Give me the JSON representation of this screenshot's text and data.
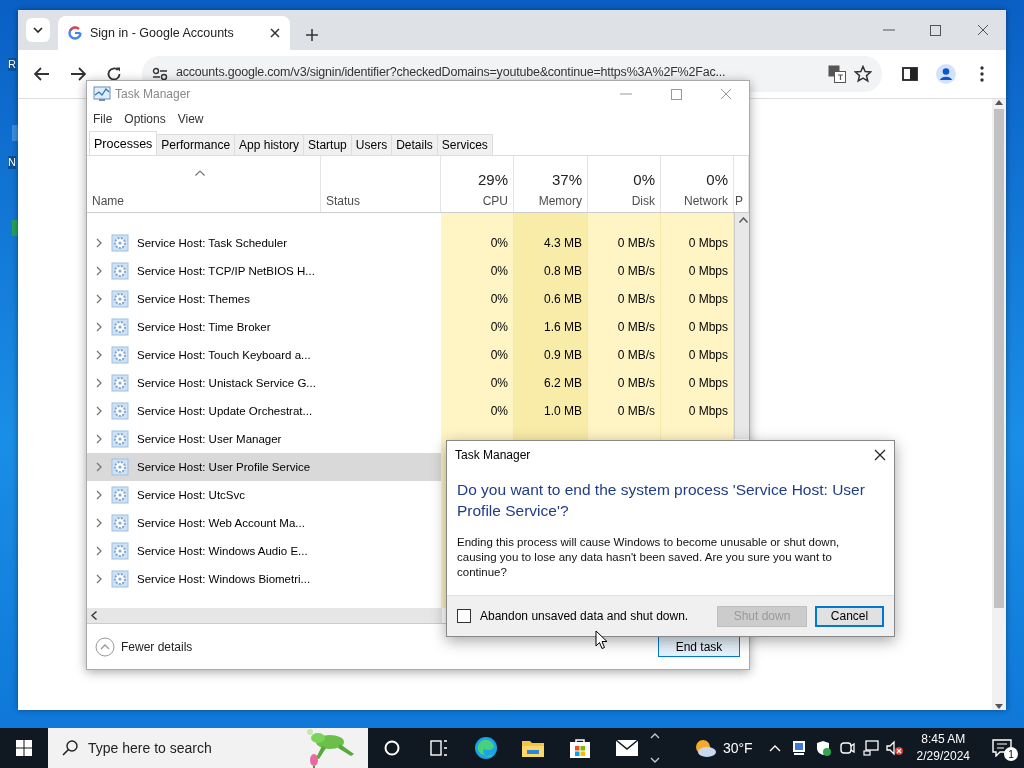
{
  "desktop": {
    "icon_labels": [
      "R",
      "N"
    ]
  },
  "browser": {
    "tabs": [
      {
        "title": "Sign in - Google Accounts",
        "selected": true
      }
    ],
    "url": "accounts.google.com/v3/signin/identifier?checkedDomains=youtube&continue=https%3A%2F%2Fac..."
  },
  "task_manager": {
    "title": "Task Manager",
    "menu": [
      "File",
      "Options",
      "View"
    ],
    "tabs": [
      {
        "label": "Processes",
        "selected": true
      },
      {
        "label": "Performance",
        "selected": false
      },
      {
        "label": "App history",
        "selected": false
      },
      {
        "label": "Startup",
        "selected": false
      },
      {
        "label": "Users",
        "selected": false
      },
      {
        "label": "Details",
        "selected": false
      },
      {
        "label": "Services",
        "selected": false
      }
    ],
    "columns": [
      {
        "label": "Name"
      },
      {
        "label": "Status"
      },
      {
        "usage": "29%",
        "label": "CPU"
      },
      {
        "usage": "37%",
        "label": "Memory"
      },
      {
        "usage": "0%",
        "label": "Disk"
      },
      {
        "usage": "0%",
        "label": "Network"
      },
      {
        "label": "P"
      }
    ],
    "rows": [
      {
        "name": "Service Host: Task Scheduler",
        "selected": false,
        "cpu": "0%",
        "memory": "4.3 MB",
        "disk": "0 MB/s",
        "network": "0 Mbps"
      },
      {
        "name": "Service Host: TCP/IP NetBIOS H...",
        "selected": false,
        "cpu": "0%",
        "memory": "0.8 MB",
        "disk": "0 MB/s",
        "network": "0 Mbps"
      },
      {
        "name": "Service Host: Themes",
        "selected": false,
        "cpu": "0%",
        "memory": "0.6 MB",
        "disk": "0 MB/s",
        "network": "0 Mbps"
      },
      {
        "name": "Service Host: Time Broker",
        "selected": false,
        "cpu": "0%",
        "memory": "1.6 MB",
        "disk": "0 MB/s",
        "network": "0 Mbps"
      },
      {
        "name": "Service Host: Touch Keyboard a...",
        "selected": false,
        "cpu": "0%",
        "memory": "0.9 MB",
        "disk": "0 MB/s",
        "network": "0 Mbps"
      },
      {
        "name": "Service Host: Unistack Service G...",
        "selected": false,
        "cpu": "0%",
        "memory": "6.2 MB",
        "disk": "0 MB/s",
        "network": "0 Mbps"
      },
      {
        "name": "Service Host: Update Orchestrat...",
        "selected": false,
        "cpu": "0%",
        "memory": "1.0 MB",
        "disk": "0 MB/s",
        "network": "0 Mbps"
      },
      {
        "name": "Service Host: User Manager",
        "selected": false
      },
      {
        "name": "Service Host: User Profile Service",
        "selected": true
      },
      {
        "name": "Service Host: UtcSvc",
        "selected": false
      },
      {
        "name": "Service Host: Web Account Ma...",
        "selected": false
      },
      {
        "name": "Service Host: Windows Audio E...",
        "selected": false
      },
      {
        "name": "Service Host: Windows Biometri...",
        "selected": false
      }
    ],
    "fewer_details": "Fewer details",
    "end_task": "End task"
  },
  "dialog": {
    "title": "Task Manager",
    "heading": "Do you want to end the system process 'Service Host: User Profile Service'?",
    "message": "Ending this process will cause Windows to become unusable or shut down, causing you to lose any data hasn't been saved. Are you sure you want to continue?",
    "checkbox": {
      "label": "Abandon unsaved data and shut down.",
      "checked": false
    },
    "buttons": [
      {
        "label": "Shut down",
        "disabled": true
      },
      {
        "label": "Cancel",
        "disabled": false
      }
    ]
  },
  "taskbar": {
    "search_placeholder": "Type here to search",
    "weather": "30°F",
    "time": "8:45 AM",
    "date": "2/29/2024",
    "notifications": "1"
  }
}
